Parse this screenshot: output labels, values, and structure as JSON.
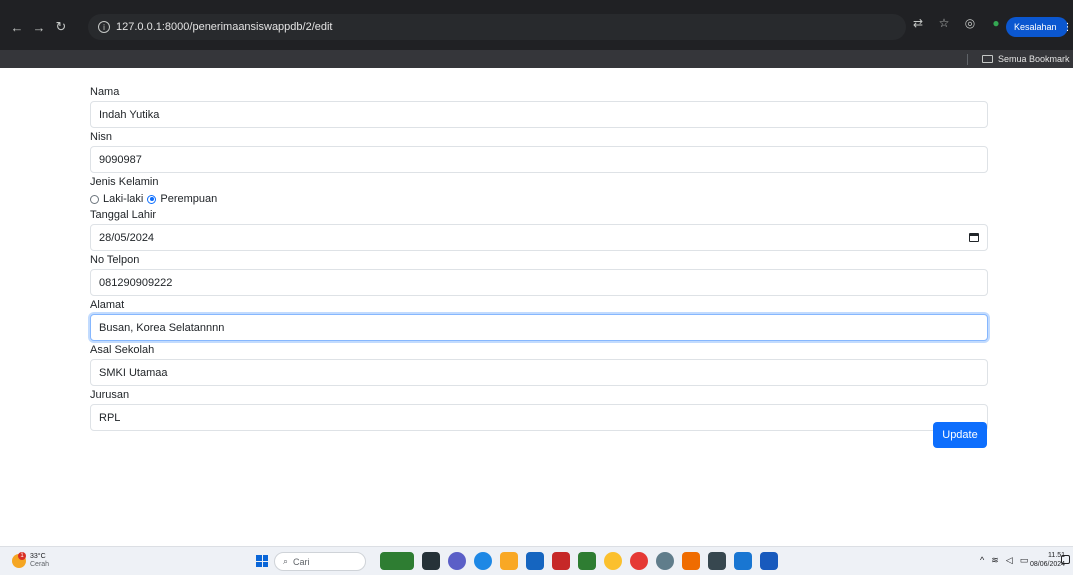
{
  "browser": {
    "url": "127.0.0.1:8000/penerimaansiswappdb/2/edit",
    "profile_label": "Kesalahan",
    "bookmark_folder": "Semua Bookmark"
  },
  "form": {
    "nama": {
      "label": "Nama",
      "value": "Indah Yutika"
    },
    "nisn": {
      "label": "Nisn",
      "value": "9090987"
    },
    "jenis_kelamin": {
      "label": "Jenis Kelamin",
      "options": [
        "Laki-laki",
        "Perempuan"
      ],
      "selected": "Perempuan"
    },
    "tanggal_lahir": {
      "label": "Tanggal Lahir",
      "value": "28/05/2024"
    },
    "no_telpon": {
      "label": "No Telpon",
      "value": "081290909222"
    },
    "alamat": {
      "label": "Alamat",
      "value": "Busan, Korea Selatannnn"
    },
    "asal_sekolah": {
      "label": "Asal Sekolah",
      "value": "SMKI Utamaa"
    },
    "jurusan": {
      "label": "Jurusan",
      "value": "RPL"
    },
    "submit_label": "Update"
  },
  "taskbar": {
    "weather_temp": "33°C",
    "weather_cond": "Cerah",
    "search_placeholder": "Cari",
    "time": "11.51",
    "date": "08/06/2024"
  },
  "colors": {
    "primary": "#0d6efd",
    "chrome": "#202124"
  }
}
